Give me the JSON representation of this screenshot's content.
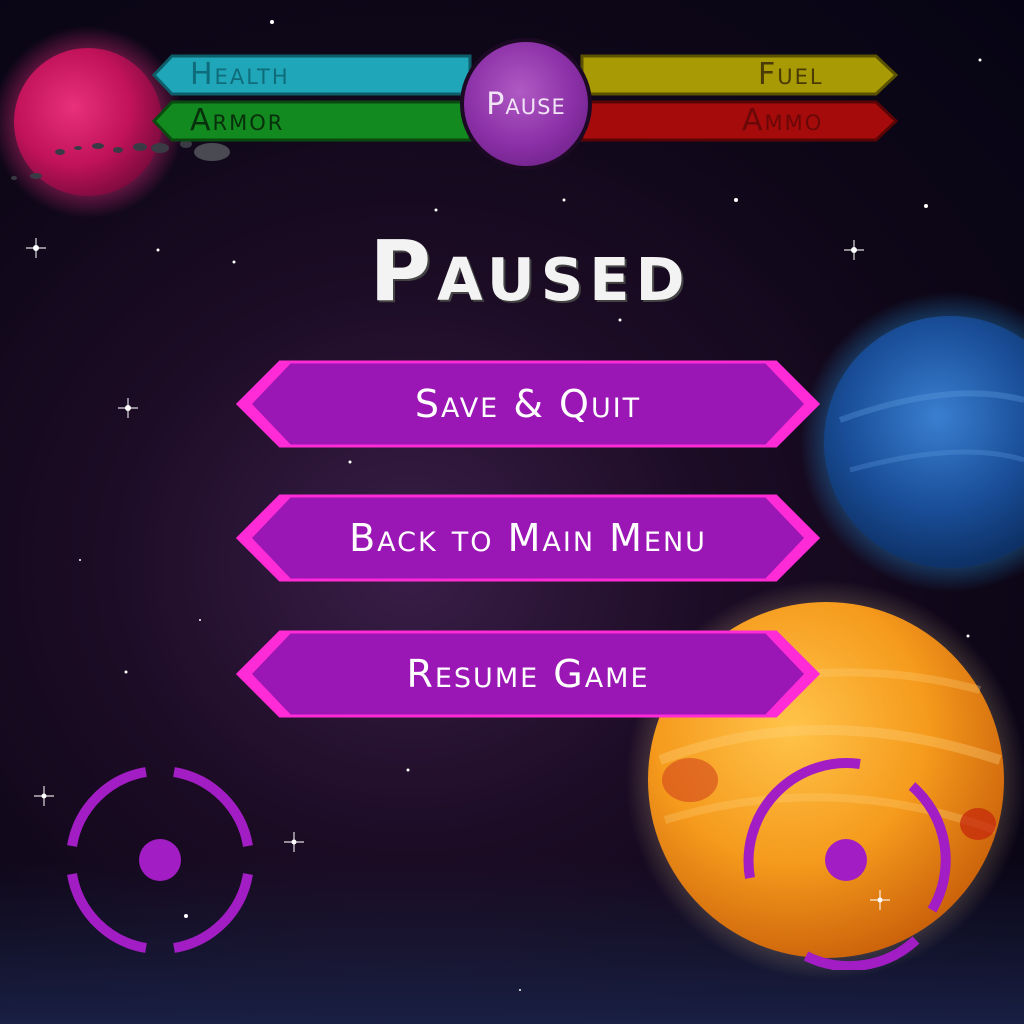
{
  "hud": {
    "health_label": "Health",
    "armor_label": "Armor",
    "fuel_label": "Fuel",
    "ammo_label": "Ammo",
    "pause_label": "Pause"
  },
  "pause_menu": {
    "title": "Paused",
    "buttons": [
      {
        "label": "Save & Quit"
      },
      {
        "label": "Back to Main Menu"
      },
      {
        "label": "Resume Game"
      }
    ]
  },
  "colors": {
    "health": "#1fa6b8",
    "armor": "#138a1f",
    "fuel": "#a89a05",
    "ammo": "#a50b0b",
    "button": "#9a16b5",
    "button_edge": "#ff2bd6",
    "joystick": "#a21ec4"
  },
  "icons": {
    "left_joystick": "move-joystick-icon",
    "right_joystick": "aim-joystick-icon"
  }
}
